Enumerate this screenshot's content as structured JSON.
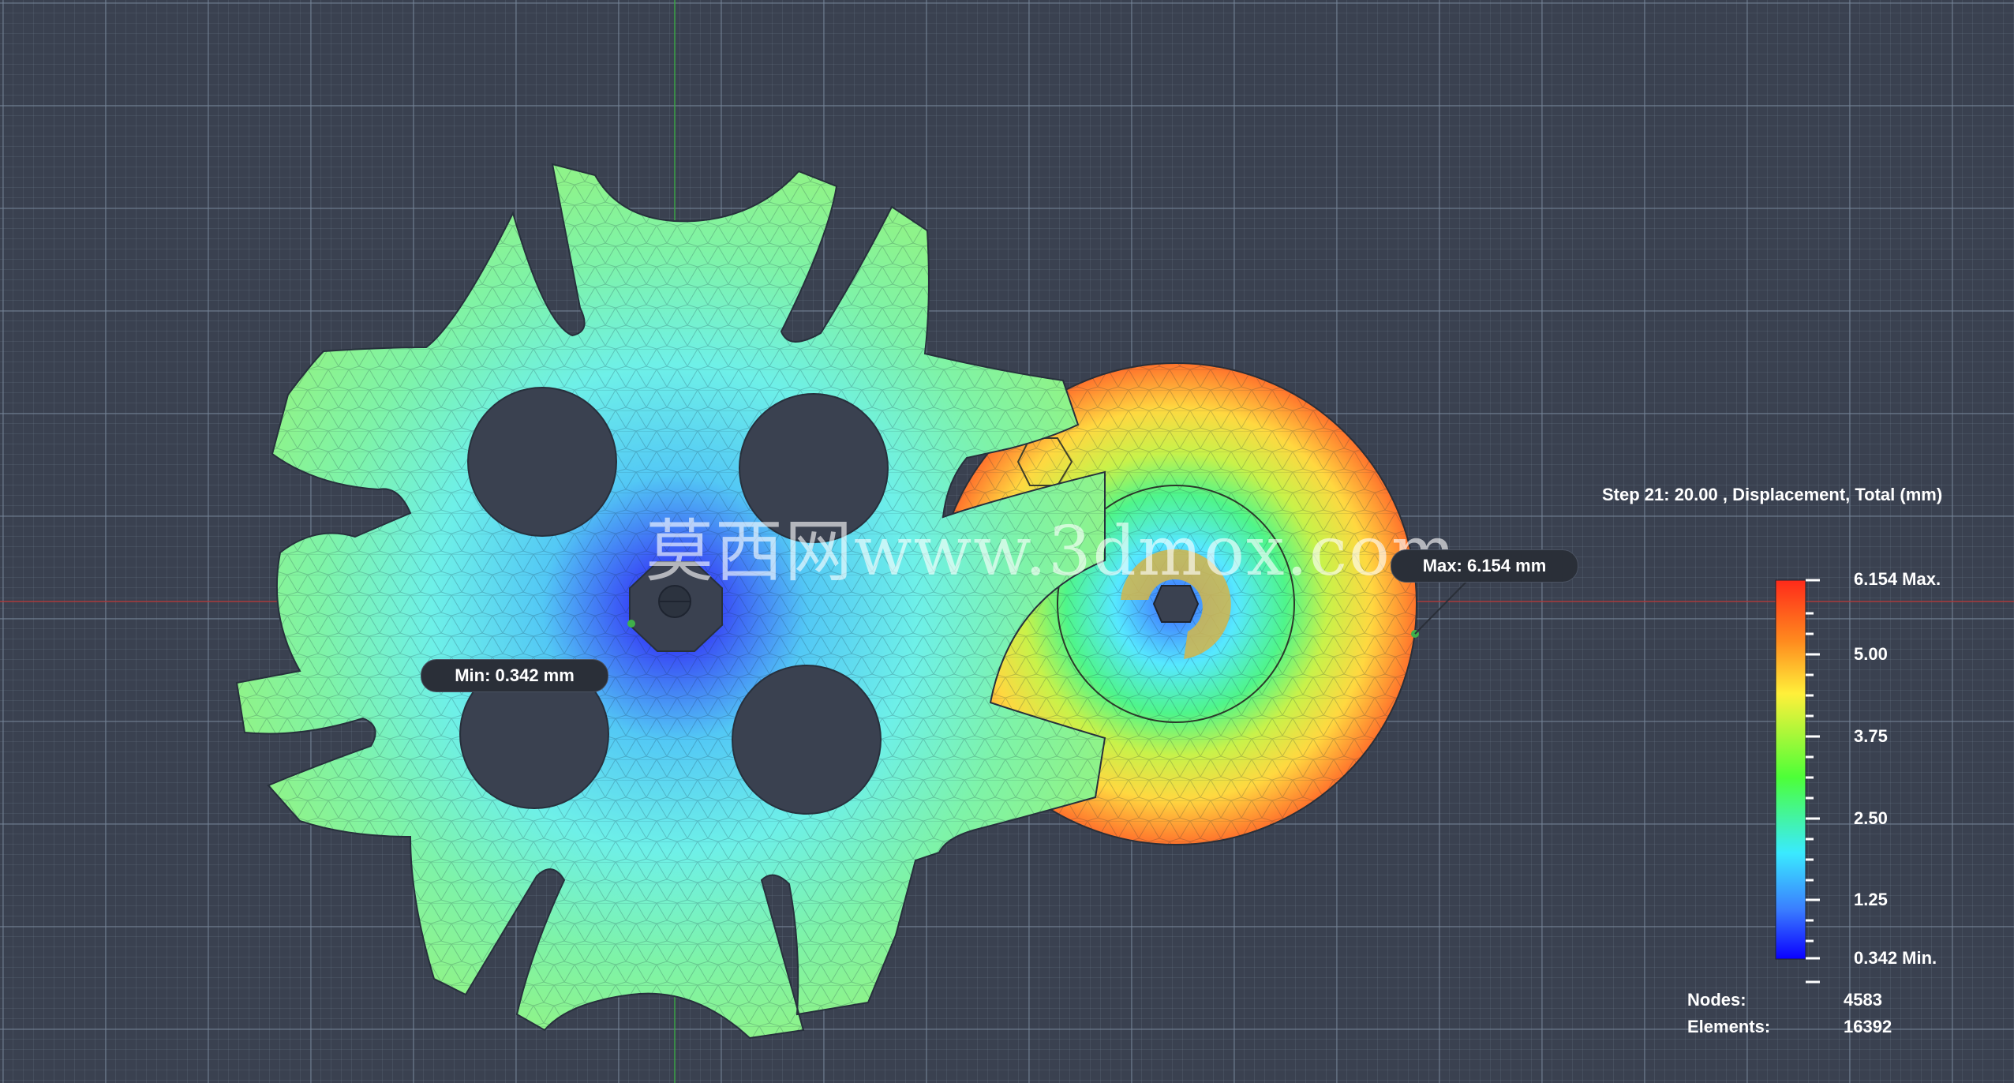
{
  "result": {
    "title": "Step 21: 20.00 , Displacement, Total (mm)",
    "min_label": "Min: 0.342 mm",
    "max_label": "Max: 6.154 mm"
  },
  "legend": {
    "max_label": "6.154 Max.",
    "tick_5": "5.00",
    "tick_375": "3.75",
    "tick_250": "2.50",
    "tick_125": "1.25",
    "min_label": "0.342 Min.",
    "colors": [
      "#ff2a1a",
      "#ff8a1e",
      "#fff03a",
      "#4dff38",
      "#3aeaff",
      "#3a7dff",
      "#0a00ff"
    ]
  },
  "stats": {
    "nodes_label": "Nodes:",
    "nodes_value": "4583",
    "elements_label": "Elements:",
    "elements_value": "16392"
  },
  "watermark": "莫西网www.3dmox.com"
}
